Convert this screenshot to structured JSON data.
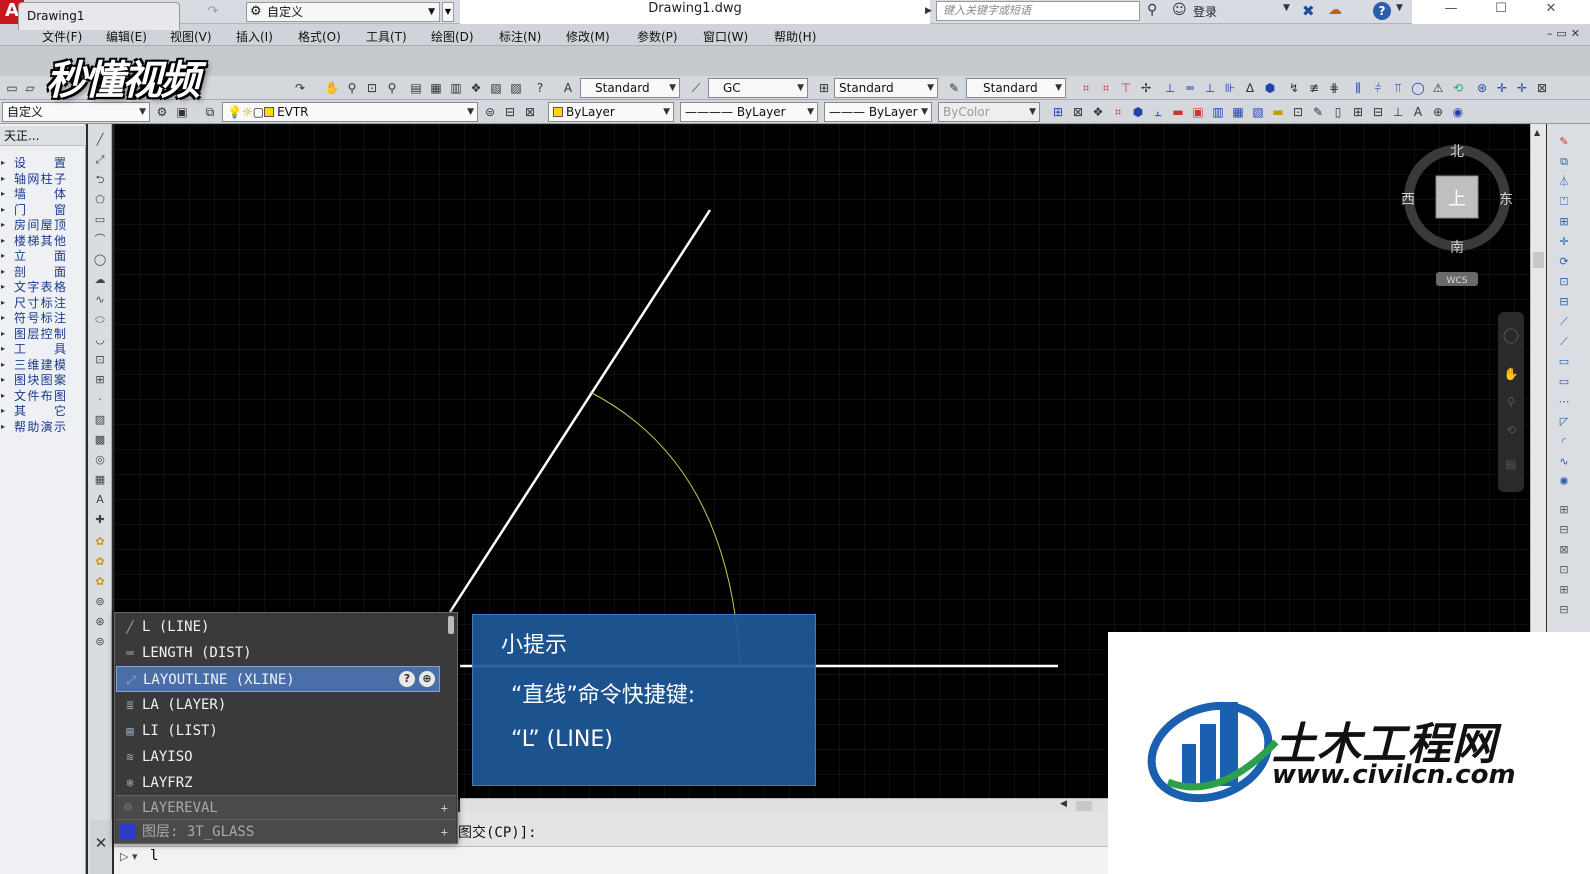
{
  "app": {
    "logo_letter": "A",
    "document_title": "Drawing1.dwg",
    "workspace": "自定义",
    "search_placeholder": "键入关键字或短语",
    "login": "登录"
  },
  "menu": [
    "文件(F)",
    "编辑(E)",
    "视图(V)",
    "插入(I)",
    "格式(O)",
    "工具(T)",
    "绘图(D)",
    "标注(N)",
    "修改(M)",
    "参数(P)",
    "窗口(W)",
    "帮助(H)"
  ],
  "tab": {
    "label": "Drawing1"
  },
  "toolbar1": {
    "text_style": "Standard",
    "dim_style": "GC",
    "table_style": "Standard",
    "mleader_style": "Standard"
  },
  "toolbar2": {
    "workspace": "自定义",
    "layer": "EVTR",
    "color": "ByLayer",
    "linetype": "ByLayer",
    "lineweight": "ByLayer",
    "plotstyle": "ByColor"
  },
  "tianzheng": {
    "title": "天正...",
    "items": [
      "设置",
      "轴网柱子",
      "墙体",
      "门窗",
      "房间屋顶",
      "楼梯其他",
      "立面",
      "剖面",
      "文字表格",
      "尺寸标注",
      "符号标注",
      "图层控制",
      "工具",
      "三维建模",
      "图块图案",
      "文件布图",
      "其它",
      "帮助演示"
    ]
  },
  "viewcube": {
    "north": "北",
    "south": "南",
    "east": "东",
    "west": "西",
    "top": "上",
    "wcs": "WCS"
  },
  "autocomplete": {
    "items": [
      {
        "label": "L (LINE)",
        "icon": "line-icon"
      },
      {
        "label": "LENGTH (DIST)",
        "icon": "dist-icon"
      },
      {
        "label": "LAYOUTLINE (XLINE)",
        "icon": "xline-icon",
        "selected": true
      },
      {
        "label": "LA (LAYER)",
        "icon": "layer-icon"
      },
      {
        "label": "LI (LIST)",
        "icon": "list-icon"
      },
      {
        "label": "LAYISO",
        "icon": "layiso-icon"
      },
      {
        "label": "LAYFRZ",
        "icon": "layfrz-icon"
      }
    ],
    "sysvar": "LAYEREVAL",
    "layer_entry": "图层: 3T_GLASS",
    "selected_help": "?"
  },
  "tip": {
    "title": "小提示",
    "line1": "“直线”命令快捷键:",
    "line2": "“L” (LINE)"
  },
  "command": {
    "history": "图交(CP)]:",
    "input": "l"
  },
  "watermark": {
    "brand": "秒懂视频"
  },
  "civil": {
    "name": "土木工程网",
    "url": "www.civilcn.com"
  },
  "colors": {
    "canvas": "#000000",
    "selection": "#4a6fa8",
    "tip_bg": "#1e5a9b",
    "arc": "#c8c850"
  }
}
